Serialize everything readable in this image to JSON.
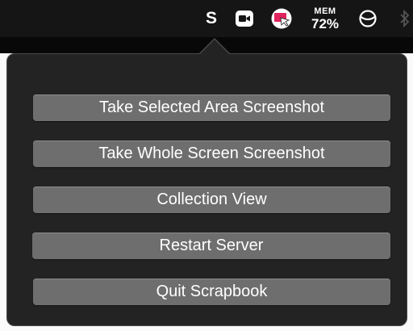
{
  "menubar": {
    "s_letter": "S",
    "zoom_icon": "zoom-video-icon",
    "scrapbook_icon": "scrapbook-icon",
    "memory": {
      "label": "MEM",
      "value": "72%"
    },
    "circle_icon": "circle-slash-icon",
    "bluetooth_icon": "bluetooth-icon"
  },
  "popover": {
    "buttons": [
      {
        "label": "Take Selected Area Screenshot"
      },
      {
        "label": "Take Whole Screen Screenshot"
      },
      {
        "label": "Collection View"
      },
      {
        "label": "Restart Server"
      },
      {
        "label": "Quit Scrapbook"
      }
    ]
  },
  "colors": {
    "menubar_bg": "#151515",
    "popover_bg": "#232323",
    "button_bg": "#6e6e6e",
    "scrapbook_icon_accent": "#e0245e"
  }
}
